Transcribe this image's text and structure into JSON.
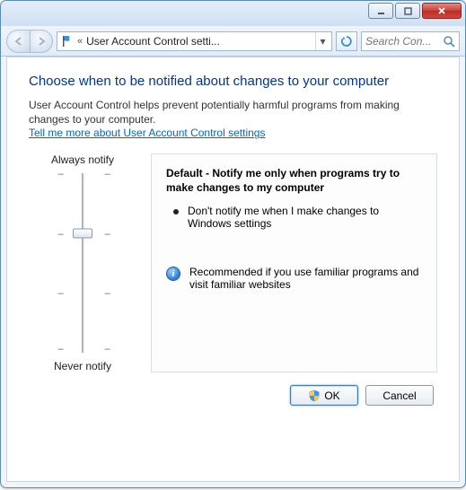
{
  "navbar": {
    "breadcrumb_prefix": "«",
    "breadcrumb_text": "User Account Control setti...",
    "search_placeholder": "Search Con..."
  },
  "page": {
    "heading": "Choose when to be notified about changes to your computer",
    "intro": "User Account Control helps prevent potentially harmful programs from making changes to your computer.",
    "help_link": "Tell me more about User Account Control settings"
  },
  "slider": {
    "top_label": "Always notify",
    "bottom_label": "Never notify",
    "levels": 4,
    "current_level": 1,
    "description_title": "Default - Notify me only when programs try to make changes to my computer",
    "bullet": "Don't notify me when I make changes to Windows settings",
    "recommendation": "Recommended if you use familiar programs and visit familiar websites"
  },
  "buttons": {
    "ok": "OK",
    "cancel": "Cancel"
  }
}
